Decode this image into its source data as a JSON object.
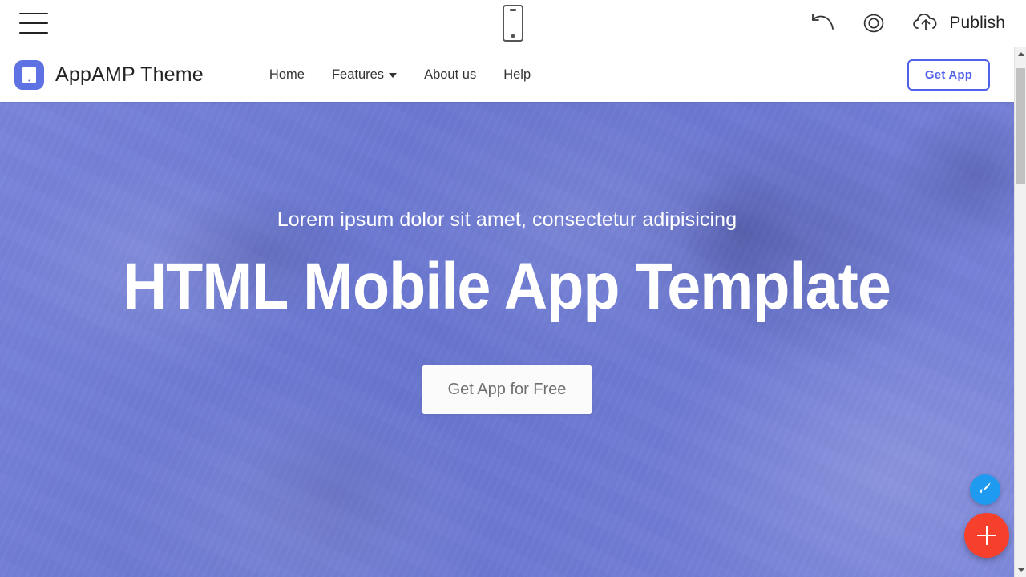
{
  "editor": {
    "menu_icon": "hamburger-menu-icon",
    "device_preview_icon": "mobile-device-icon",
    "undo_icon": "undo-arrow-icon",
    "preview_icon": "eye-preview-icon",
    "publish_icon": "cloud-upload-icon",
    "publish_label": "Publish"
  },
  "site": {
    "brand": {
      "logo_icon": "tablet-app-logo-icon",
      "name": "AppAMP Theme",
      "logo_color": "#5f72e4"
    },
    "nav_links": [
      {
        "label": "Home",
        "has_dropdown": false
      },
      {
        "label": "Features",
        "has_dropdown": true
      },
      {
        "label": "About us",
        "has_dropdown": false
      },
      {
        "label": "Help",
        "has_dropdown": false
      }
    ],
    "cta_label": "Get App",
    "cta_color": "#5162e8"
  },
  "hero": {
    "subtitle": "Lorem ipsum dolor sit amet, consectetur adipisicing",
    "title": "HTML Mobile App Template",
    "button_label": "Get App for Free",
    "overlay_color": "#626ed2",
    "text_color": "#ffffff"
  },
  "fabs": {
    "brush": {
      "icon": "paintbrush-icon",
      "color": "#1e9bf0"
    },
    "add": {
      "icon": "plus-icon",
      "color": "#f6402c"
    }
  },
  "scrollbar": {
    "up_icon": "scroll-up-arrow-icon",
    "down_icon": "scroll-down-arrow-icon",
    "thumb": "scrollbar-thumb"
  }
}
